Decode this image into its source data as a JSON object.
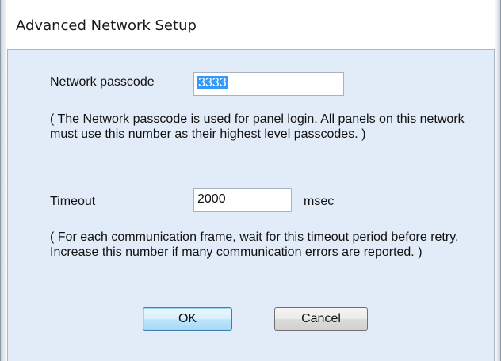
{
  "window": {
    "title": "Advanced Network Setup"
  },
  "passcode": {
    "label": "Network passcode",
    "value": "3333",
    "note": "( The Network passcode is used for panel login.  All panels on this network must use this number as their highest level passcodes. )"
  },
  "timeout": {
    "label": "Timeout",
    "value": "2000",
    "unit": "msec",
    "note": "( For each communication frame, wait for this timeout period before retry. Increase this number if many communication errors are reported. )"
  },
  "buttons": {
    "ok_label": "OK",
    "cancel_label": "Cancel"
  },
  "colors": {
    "client_background": "#e2ecf8",
    "selection": "#3399ff"
  }
}
